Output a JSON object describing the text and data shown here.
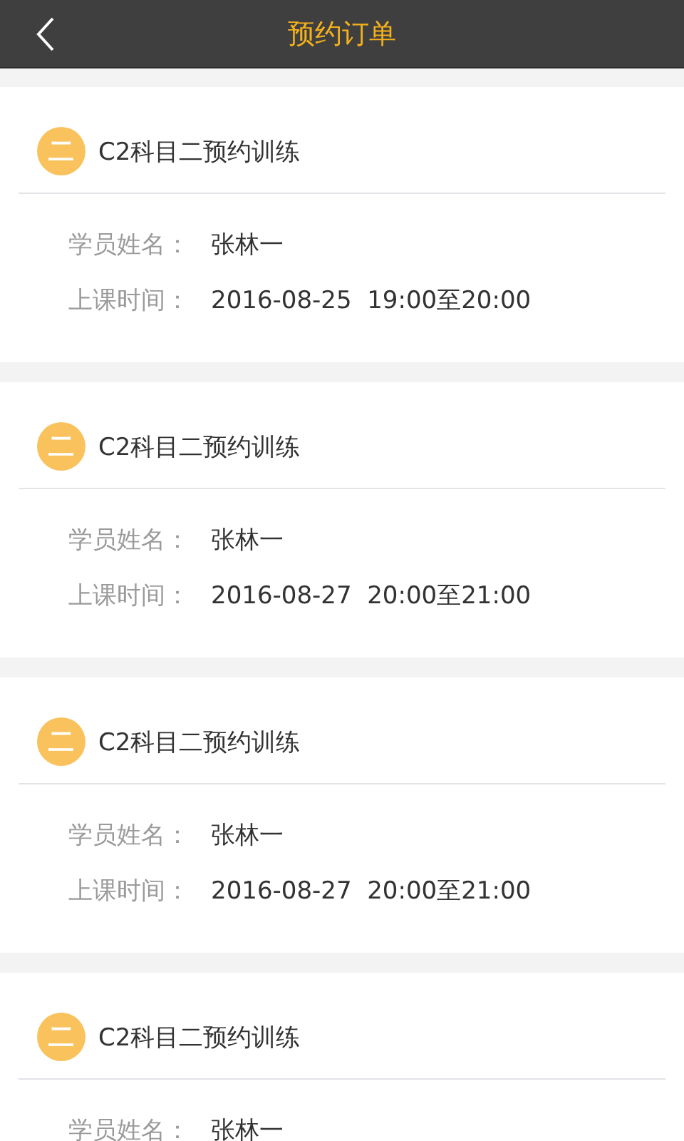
{
  "header": {
    "title": "预约订单"
  },
  "orders": [
    {
      "badge": "二",
      "title": "C2科目二预约训练",
      "fields": [
        {
          "label": "学员姓名：",
          "value": "张林一"
        },
        {
          "label": "上课时间：",
          "value": "2016-08-25  19:00至20:00"
        }
      ]
    },
    {
      "badge": "二",
      "title": "C2科目二预约训练",
      "fields": [
        {
          "label": "学员姓名：",
          "value": "张林一"
        },
        {
          "label": "上课时间：",
          "value": "2016-08-27  20:00至21:00"
        }
      ]
    },
    {
      "badge": "二",
      "title": "C2科目二预约训练",
      "fields": [
        {
          "label": "学员姓名：",
          "value": "张林一"
        },
        {
          "label": "上课时间：",
          "value": "2016-08-27  20:00至21:00"
        }
      ]
    },
    {
      "badge": "二",
      "title": "C2科目二预约训练",
      "fields": [
        {
          "label": "学员姓名：",
          "value": "张林一"
        }
      ]
    }
  ]
}
